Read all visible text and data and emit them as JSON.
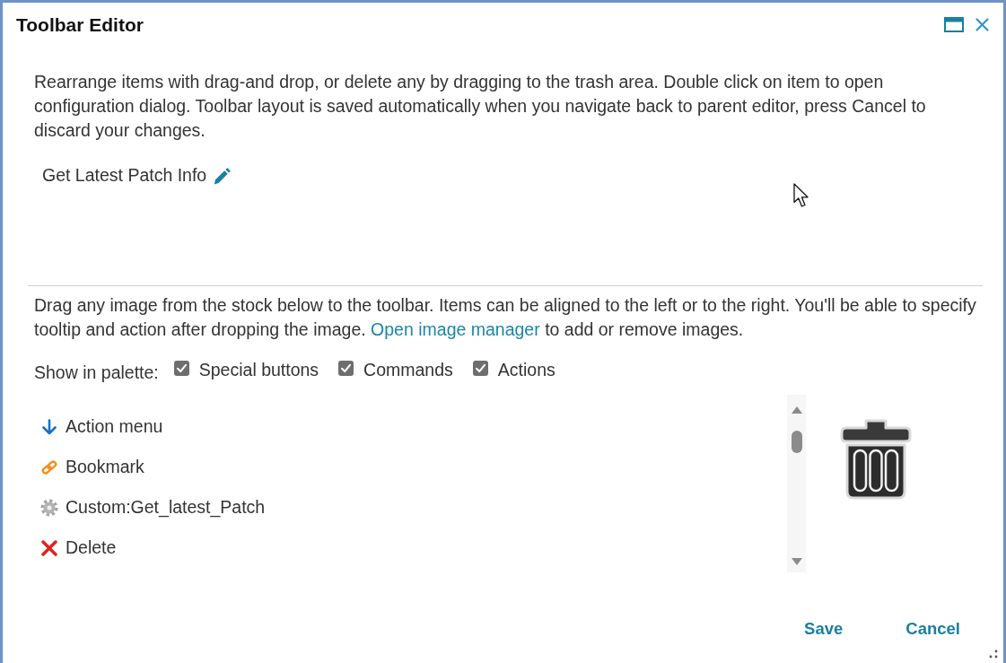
{
  "window": {
    "title": "Toolbar Editor"
  },
  "instructions": "Rearrange items with drag-and drop, or delete any by dragging to the trash area. Double click on item to open configuration dialog. Toolbar layout is saved automatically when you navigate back to parent editor, press Cancel to discard your changes.",
  "toolbar": {
    "items": [
      {
        "label": "Get Latest Patch Info"
      }
    ]
  },
  "stock_hint": {
    "text": "Drag any image from the stock below to the toolbar. Items can be aligned to the left or to the right. You'll be able to specify tooltip and action after dropping the image.",
    "link": "Open image manager",
    "text_after": "to add or remove images."
  },
  "palette_filter": {
    "label": "Show in palette:",
    "options": [
      {
        "label": "Special buttons",
        "checked": true
      },
      {
        "label": "Commands",
        "checked": true
      },
      {
        "label": "Actions",
        "checked": true
      }
    ]
  },
  "palette": {
    "items": [
      {
        "kind": "menu",
        "label": "Action menu"
      },
      {
        "kind": "bookmark",
        "label": "Bookmark"
      },
      {
        "kind": "custom",
        "label": "Custom:Get_latest_Patch"
      },
      {
        "kind": "delete",
        "label": "Delete"
      }
    ]
  },
  "buttons": [
    {
      "label": "Save"
    },
    {
      "label": "Cancel"
    }
  ]
}
